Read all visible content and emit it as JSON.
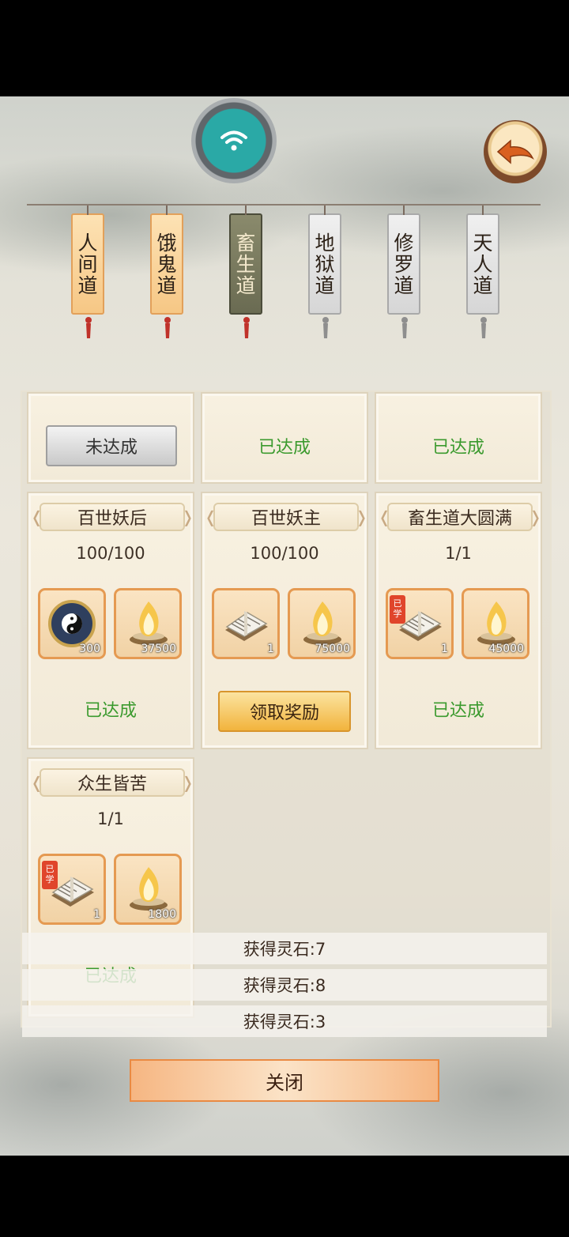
{
  "tabs": [
    {
      "label": "人间道",
      "state": "orange"
    },
    {
      "label": "饿鬼道",
      "state": "orange"
    },
    {
      "label": "畜生道",
      "state": "active"
    },
    {
      "label": "地狱道",
      "state": "gray"
    },
    {
      "label": "修罗道",
      "state": "gray"
    },
    {
      "label": "天人道",
      "state": "gray"
    }
  ],
  "top_row": {
    "card1_button": "未达成",
    "card2_status": "已达成",
    "card3_status": "已达成"
  },
  "cards": [
    {
      "title": "百世妖后",
      "progress": "100/100",
      "rewards": [
        {
          "icon": "taiji-compass-icon",
          "count": "300"
        },
        {
          "icon": "spirit-flame-icon",
          "count": "37500"
        }
      ],
      "status": "已达成"
    },
    {
      "title": "百世妖主",
      "progress": "100/100",
      "rewards": [
        {
          "icon": "skill-book-icon",
          "count": "1"
        },
        {
          "icon": "spirit-flame-icon",
          "count": "75000"
        }
      ],
      "button": "领取奖励"
    },
    {
      "title": "畜生道大圆满",
      "progress": "1/1",
      "rewards": [
        {
          "icon": "skill-book-icon",
          "count": "1",
          "badge": "已学"
        },
        {
          "icon": "spirit-flame-icon",
          "count": "45000"
        }
      ],
      "status": "已达成"
    },
    {
      "title": "众生皆苦",
      "progress": "1/1",
      "rewards": [
        {
          "icon": "skill-book-icon",
          "count": "1",
          "badge": "已学"
        },
        {
          "icon": "spirit-flame-icon",
          "count": "1800"
        }
      ],
      "status": "已达成"
    }
  ],
  "toasts": [
    "获得灵石:7",
    "获得灵石:8",
    "获得灵石:3"
  ],
  "close_label": "关闭",
  "icons": {
    "wifi": "wifi-icon",
    "back": "back-arrow-icon"
  },
  "colors": {
    "achieved": "#3b9a2e",
    "claim": "#f2b43d",
    "frame": "#e59a52"
  }
}
